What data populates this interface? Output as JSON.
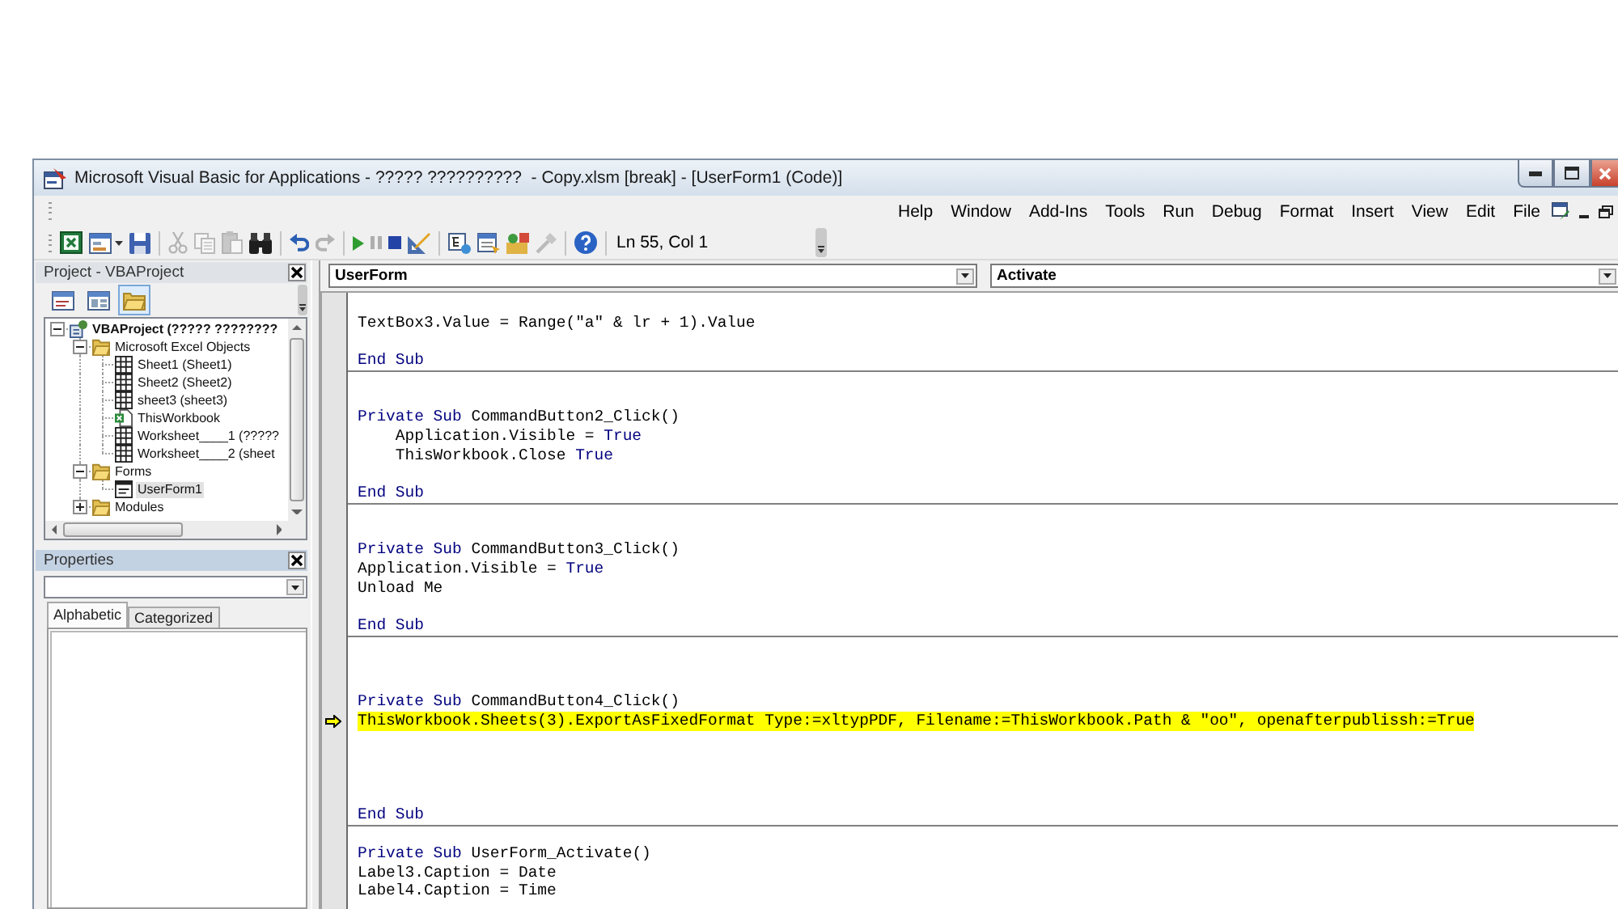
{
  "window": {
    "title": "Microsoft Visual Basic for Applications - ????? ??????????  - Copy.xlsm [break] - [UserForm1 (Code)]"
  },
  "menu": [
    "Help",
    "Window",
    "Add-Ins",
    "Tools",
    "Run",
    "Debug",
    "Format",
    "Insert",
    "View",
    "Edit",
    "File"
  ],
  "toolbar": {
    "items": [
      {
        "kind": "excel",
        "disabled": false
      },
      {
        "kind": "userform",
        "disabled": false
      },
      {
        "kind": "save",
        "disabled": false
      },
      {
        "kind": "separator"
      },
      {
        "kind": "cut",
        "disabled": true
      },
      {
        "kind": "copy",
        "disabled": true
      },
      {
        "kind": "paste",
        "disabled": true
      },
      {
        "kind": "find",
        "disabled": false
      },
      {
        "kind": "separator"
      },
      {
        "kind": "undo",
        "disabled": false
      },
      {
        "kind": "redo",
        "disabled": true
      },
      {
        "kind": "separator"
      },
      {
        "kind": "run",
        "disabled": false
      },
      {
        "kind": "break",
        "disabled": true
      },
      {
        "kind": "reset",
        "disabled": false
      },
      {
        "kind": "design",
        "disabled": false
      },
      {
        "kind": "separator"
      },
      {
        "kind": "explorer",
        "disabled": false
      },
      {
        "kind": "properties",
        "disabled": false
      },
      {
        "kind": "browser",
        "disabled": false
      },
      {
        "kind": "toolbox",
        "disabled": true
      },
      {
        "kind": "separator"
      },
      {
        "kind": "help",
        "disabled": false
      },
      {
        "kind": "separator"
      }
    ],
    "cursor_position": "Ln 55, Col 1"
  },
  "project_explorer": {
    "title": "Project - VBAProject",
    "active": false,
    "toolbar": [
      {
        "kind": "code",
        "pressed": false
      },
      {
        "kind": "object",
        "pressed": false
      },
      {
        "kind": "folders",
        "pressed": true
      }
    ],
    "tree": [
      {
        "kind": "project",
        "label": "VBAProject (????? ????????",
        "expanded": true,
        "selected": false,
        "children": [
          {
            "kind": "folder",
            "label": "Microsoft Excel Objects",
            "expanded": true,
            "selected": false,
            "children": [
              {
                "kind": "sheet",
                "label": "Sheet1 (Sheet1)",
                "selected": false
              },
              {
                "kind": "sheet",
                "label": "Sheet2 (Sheet2)",
                "selected": false
              },
              {
                "kind": "sheet",
                "label": "sheet3 (sheet3)",
                "selected": false
              },
              {
                "kind": "workbook",
                "label": "ThisWorkbook",
                "selected": false
              },
              {
                "kind": "sheet",
                "label": "Worksheet____1 (?????",
                "selected": false
              },
              {
                "kind": "sheet",
                "label": "Worksheet____2 (sheet",
                "selected": false
              }
            ]
          },
          {
            "kind": "folder",
            "label": "Forms",
            "expanded": true,
            "selected": false,
            "children": [
              {
                "kind": "form",
                "label": "UserForm1",
                "selected": true
              }
            ]
          },
          {
            "kind": "folder",
            "label": "Modules",
            "expanded": false,
            "selected": false
          }
        ]
      }
    ]
  },
  "properties": {
    "title": "Properties",
    "active": true,
    "tabs": [
      {
        "label": "Alphabetic",
        "selected": true
      },
      {
        "label": "Categorized",
        "selected": false
      }
    ]
  },
  "code_window": {
    "object": "UserForm",
    "procedure": "Activate",
    "blocks": [
      {
        "lines": [
          {
            "kind": "blank",
            "current": false
          },
          {
            "kind": "code",
            "current": false,
            "indent": false,
            "parts": [
              {
                "kind": "plain",
                "text": "TextBox3.Value = Range(\"a\" & lr + 1).Value"
              }
            ]
          },
          {
            "kind": "blank",
            "current": false
          },
          {
            "kind": "code",
            "current": false,
            "indent": false,
            "parts": [
              {
                "kind": "keyword",
                "text": "End Sub"
              }
            ]
          }
        ]
      },
      {
        "lines": [
          {
            "kind": "blank",
            "current": false
          },
          {
            "kind": "blank",
            "current": false
          },
          {
            "kind": "code",
            "current": false,
            "indent": false,
            "parts": [
              {
                "kind": "keyword",
                "text": "Private Sub"
              },
              {
                "kind": "plain",
                "text": " CommandButton2_Click()"
              }
            ]
          },
          {
            "kind": "code",
            "current": false,
            "indent": true,
            "parts": [
              {
                "kind": "plain",
                "text": "Application.Visible = "
              },
              {
                "kind": "keyword",
                "text": "True"
              }
            ]
          },
          {
            "kind": "code",
            "current": false,
            "indent": true,
            "parts": [
              {
                "kind": "plain",
                "text": "ThisWorkbook.Close "
              },
              {
                "kind": "keyword",
                "text": "True"
              }
            ]
          },
          {
            "kind": "blank",
            "current": false
          },
          {
            "kind": "code",
            "current": false,
            "indent": false,
            "parts": [
              {
                "kind": "keyword",
                "text": "End Sub"
              }
            ]
          }
        ]
      },
      {
        "lines": [
          {
            "kind": "blank",
            "current": false
          },
          {
            "kind": "blank",
            "current": false
          },
          {
            "kind": "code",
            "current": false,
            "indent": false,
            "parts": [
              {
                "kind": "keyword",
                "text": "Private Sub"
              },
              {
                "kind": "plain",
                "text": " CommandButton3_Click()"
              }
            ]
          },
          {
            "kind": "code",
            "current": false,
            "indent": false,
            "parts": [
              {
                "kind": "plain",
                "text": "Application.Visible = "
              },
              {
                "kind": "keyword",
                "text": "True"
              }
            ]
          },
          {
            "kind": "code",
            "current": false,
            "indent": false,
            "parts": [
              {
                "kind": "plain",
                "text": "Unload Me"
              }
            ]
          },
          {
            "kind": "blank",
            "current": false
          },
          {
            "kind": "code",
            "current": false,
            "indent": false,
            "parts": [
              {
                "kind": "keyword",
                "text": "End Sub"
              }
            ]
          }
        ]
      },
      {
        "lines": [
          {
            "kind": "blank",
            "current": false
          },
          {
            "kind": "blank",
            "current": false
          },
          {
            "kind": "blank",
            "current": false
          },
          {
            "kind": "code",
            "current": false,
            "indent": false,
            "parts": [
              {
                "kind": "keyword",
                "text": "Private Sub"
              },
              {
                "kind": "plain",
                "text": " CommandButton4_Click()"
              }
            ]
          },
          {
            "kind": "code",
            "current": true,
            "indent": false,
            "parts": [
              {
                "kind": "plain",
                "text": "ThisWorkbook.Sheets(3).ExportAsFixedFormat Type:=xltypPDF, Filename:=ThisWorkbook.Path & \"oo\", openafterpublissh:=True"
              }
            ]
          },
          {
            "kind": "blank",
            "current": false
          },
          {
            "kind": "blank",
            "current": false
          },
          {
            "kind": "blank",
            "current": false
          },
          {
            "kind": "blank",
            "current": false
          },
          {
            "kind": "code",
            "current": false,
            "indent": false,
            "parts": [
              {
                "kind": "keyword",
                "text": "End Sub"
              }
            ]
          }
        ]
      },
      {
        "lines": [
          {
            "kind": "blank",
            "current": false
          },
          {
            "kind": "code",
            "current": false,
            "indent": false,
            "parts": [
              {
                "kind": "keyword",
                "text": "Private Sub"
              },
              {
                "kind": "plain",
                "text": " UserForm_Activate()"
              }
            ]
          },
          {
            "kind": "code",
            "current": false,
            "indent": false,
            "parts": [
              {
                "kind": "plain",
                "text": "Label3.Caption = Date"
              }
            ]
          },
          {
            "kind": "code",
            "current": false,
            "indent": false,
            "parts": [
              {
                "kind": "plain",
                "text": "Label4.Caption = Time"
              }
            ]
          }
        ]
      }
    ]
  }
}
